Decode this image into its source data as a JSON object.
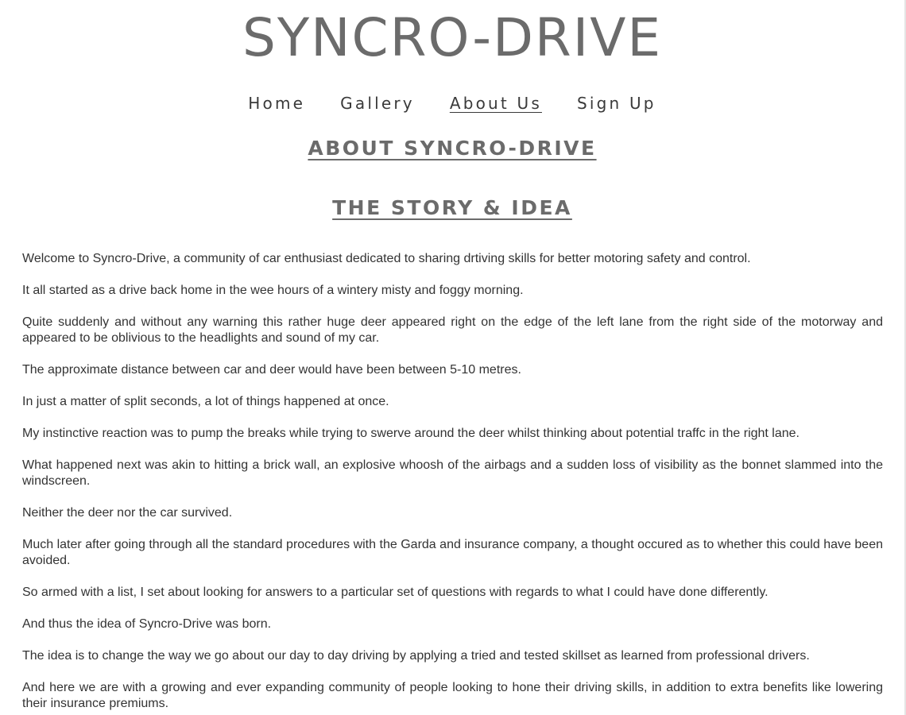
{
  "site": {
    "logo_text": "SYNCRO-DRIVE"
  },
  "nav": {
    "items": [
      {
        "label": "Home",
        "active": false
      },
      {
        "label": "Gallery",
        "active": false
      },
      {
        "label": "About Us",
        "active": true
      },
      {
        "label": "Sign Up",
        "active": false
      }
    ]
  },
  "main": {
    "heading": "ABOUT SYNCRO-DRIVE",
    "subheading": "THE STORY & IDEA",
    "paragraphs": [
      "Welcome to Syncro-Drive, a community of car enthusiast dedicated to sharing drtiving skills for better motoring safety and control.",
      "It all started as a drive back home in the wee hours of a wintery misty and foggy morning.",
      "Quite suddenly and without any warning this rather huge deer appeared right on the edge of the left lane from the right side of the motorway and appeared to be oblivious to the headlights and sound of my car.",
      "The approximate distance between car and deer would have been between 5-10 metres.",
      "In just a matter of split seconds, a lot of things happened at once.",
      "My instinctive reaction was to pump the breaks while trying to swerve around the deer whilst thinking about potential traffc in the right lane.",
      "What happened next was akin to hitting a brick wall, an explosive whoosh of the airbags and a sudden loss of visibility as the bonnet slammed into the windscreen.",
      "Neither the deer nor the car survived.",
      "Much later after going through all the standard procedures with the Garda and insurance company, a thought occured as to whether this could have been avoided.",
      "So armed with a list, I set about looking for answers to a particular set of questions with regards to what I could have done differently.",
      "And thus the idea of Syncro-Drive was born.",
      "The idea is to change the way we go about our day to day driving by applying a tried and tested skillset as learned from professional drivers.",
      "And here we are with a growing and ever expanding community of people looking to hone their driving skills, in addition to extra benefits like lowering their insurance premiums."
    ]
  }
}
